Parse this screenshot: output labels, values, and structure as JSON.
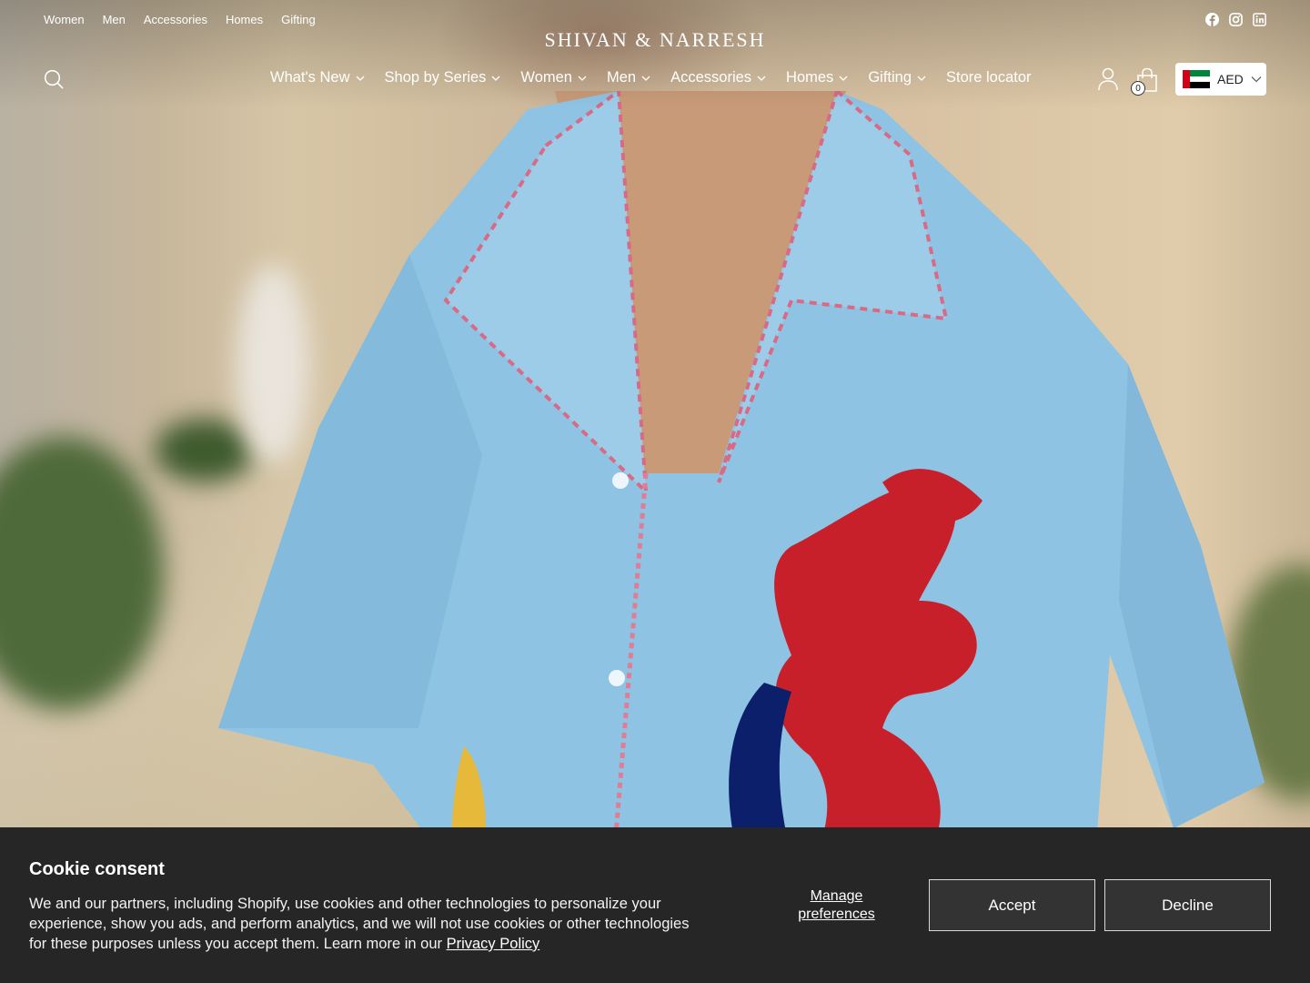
{
  "utility_nav": {
    "links": [
      "Women",
      "Men",
      "Accessories",
      "Homes",
      "Gifting"
    ]
  },
  "social_icons": [
    "facebook-icon",
    "instagram-icon",
    "linkedin-icon"
  ],
  "brand": {
    "logo_text": "SHIVAN & NARRESH"
  },
  "main_nav": {
    "items": [
      {
        "label": "What's New",
        "has_dropdown": true
      },
      {
        "label": "Shop by Series",
        "has_dropdown": true
      },
      {
        "label": "Women",
        "has_dropdown": true
      },
      {
        "label": "Men",
        "has_dropdown": true
      },
      {
        "label": "Accessories",
        "has_dropdown": true
      },
      {
        "label": "Homes",
        "has_dropdown": true
      },
      {
        "label": "Gifting",
        "has_dropdown": true
      },
      {
        "label": "Store locator",
        "has_dropdown": false
      }
    ]
  },
  "header_actions": {
    "cart_count": "0",
    "currency": {
      "code": "AED",
      "flag": "uae-flag"
    }
  },
  "cookie_banner": {
    "title": "Cookie consent",
    "body": "We and our partners, including Shopify, use cookies and other technologies to personalize your experience, show you ads, and perform analytics, and we will not use cookies or other technologies for these purposes unless you accept them. Learn more in our ",
    "privacy_link": "Privacy Policy",
    "manage_label": "Manage preferences",
    "accept_label": "Accept",
    "decline_label": "Decline"
  },
  "colors": {
    "banner_bg": "#262626",
    "shirt_blue": "#8fc3e3",
    "embroidery_red": "#c8202a",
    "embroidery_navy": "#0c1f6b"
  }
}
